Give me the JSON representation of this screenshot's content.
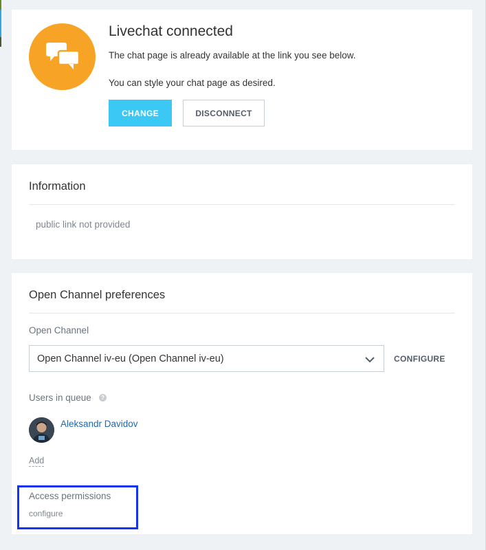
{
  "connection": {
    "title": "Livechat connected",
    "line1": "The chat page is already available at the link you see below.",
    "line2": "You can style your chat page as desired.",
    "change_label": "CHANGE",
    "disconnect_label": "DISCONNECT",
    "icon": "chat-bubbles-icon",
    "accent": "#f7a325"
  },
  "information": {
    "title": "Information",
    "text": "public link not provided"
  },
  "open_channel": {
    "title": "Open Channel preferences",
    "field_label": "Open Channel",
    "selected": "Open Channel iv-eu (Open Channel iv-eu)",
    "configure_label": "CONFIGURE",
    "queue_label": "Users in queue",
    "queue_help": "?",
    "users": [
      {
        "name": "Aleksandr Davidov"
      }
    ],
    "add_label": "Add",
    "access_title": "Access permissions",
    "access_link": "configure"
  },
  "colors": {
    "button_primary": "#3bc8f5",
    "link": "#2067b0",
    "highlight_box": "#1433f0"
  }
}
